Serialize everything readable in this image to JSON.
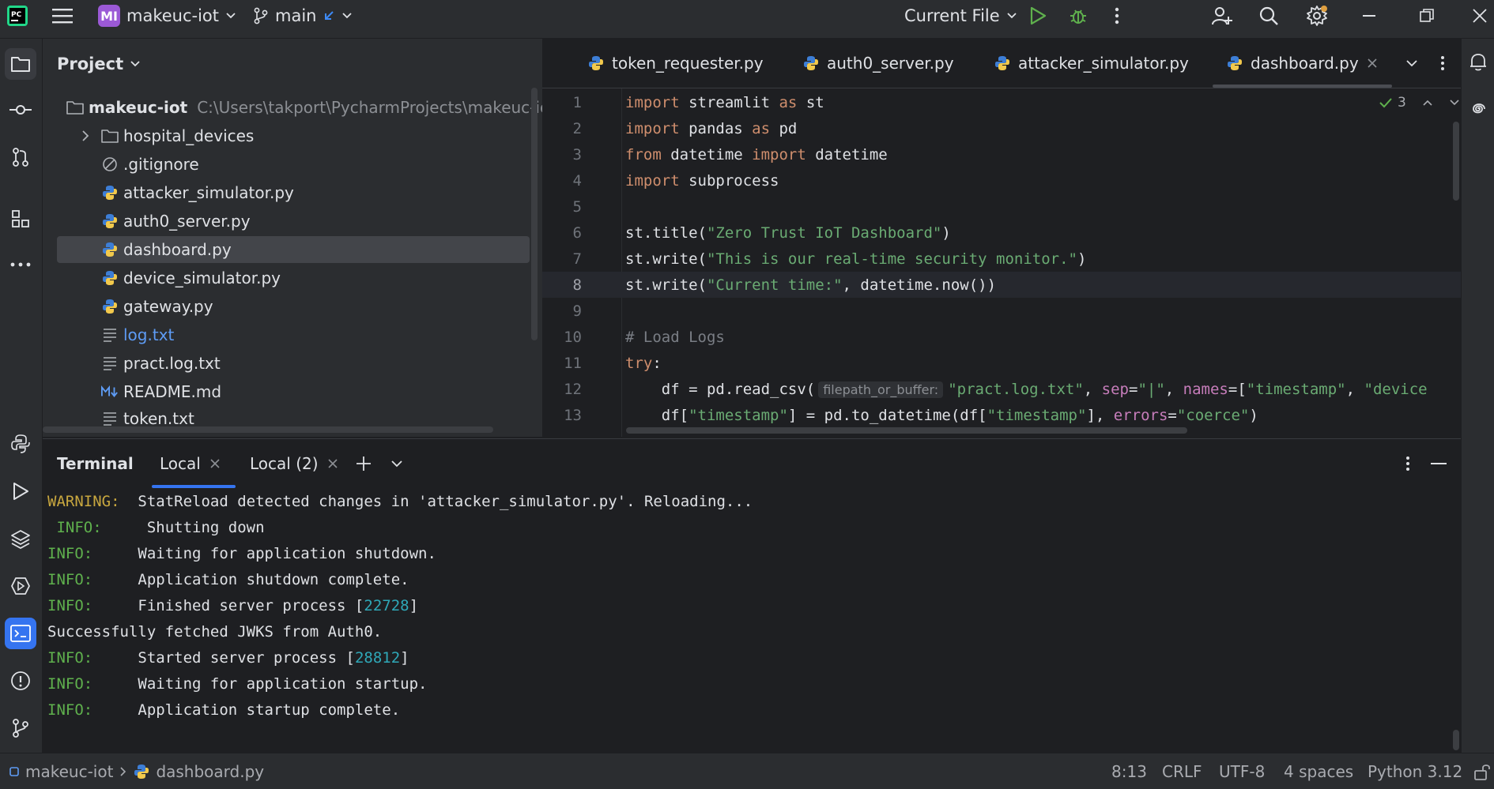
{
  "titlebar": {
    "project_badge": "MI",
    "project_name": "makeuc-iot",
    "branch": "main",
    "run_config": "Current File"
  },
  "project_panel": {
    "title": "Project",
    "root_name": "makeuc-iot",
    "root_path": "C:\\Users\\takport\\PycharmProjects\\makeuc-iot",
    "items": [
      {
        "label": "hospital_devices",
        "icon": "folder-icon"
      },
      {
        "label": ".gitignore",
        "icon": "ignore-file-icon"
      },
      {
        "label": "attacker_simulator.py",
        "icon": "python-file-icon"
      },
      {
        "label": "auth0_server.py",
        "icon": "python-file-icon"
      },
      {
        "label": "dashboard.py",
        "icon": "python-file-icon"
      },
      {
        "label": "device_simulator.py",
        "icon": "python-file-icon"
      },
      {
        "label": "gateway.py",
        "icon": "python-file-icon"
      },
      {
        "label": "log.txt",
        "icon": "text-file-icon"
      },
      {
        "label": "pract.log.txt",
        "icon": "text-file-icon"
      },
      {
        "label": "README.md",
        "icon": "markdown-file-icon"
      },
      {
        "label": "token.txt",
        "icon": "text-file-icon"
      }
    ]
  },
  "editor": {
    "tabs": [
      "token_requester.py",
      "auth0_server.py",
      "attacker_simulator.py",
      "dashboard.py"
    ],
    "active_tab": "dashboard.py",
    "inspection_count": "3",
    "line_numbers": [
      "1",
      "2",
      "3",
      "4",
      "5",
      "6",
      "7",
      "8",
      "9",
      "10",
      "11",
      "12",
      "13"
    ],
    "inlay_hint": "filepath_or_buffer:",
    "code": {
      "l1": {
        "a": "import",
        "b": " streamlit ",
        "c": "as",
        "d": " st"
      },
      "l2": {
        "a": "import",
        "b": " pandas ",
        "c": "as",
        "d": " pd"
      },
      "l3": {
        "a": "from",
        "b": " datetime ",
        "c": "import",
        "d": " datetime"
      },
      "l4": {
        "a": "import",
        "b": " subprocess"
      },
      "l6": {
        "a": "st.title(",
        "b": "\"Zero Trust IoT Dashboard\"",
        "c": ")"
      },
      "l7": {
        "a": "st.write(",
        "b": "\"This is our real-time security monitor.\"",
        "c": ")"
      },
      "l8": {
        "a": "st.write(",
        "b": "\"Current time:\"",
        "c": ", datetime.now())"
      },
      "l10": {
        "a": "# Load Logs"
      },
      "l11": {
        "a": "try",
        "b": ":"
      },
      "l12": {
        "a": "    df = pd.read_csv(",
        "b": "\"pract.log.txt\"",
        "c": ", ",
        "d": "sep",
        "e": "=",
        "f": "\"|\"",
        "g": ", ",
        "h": "names",
        "i": "=[",
        "j": "\"timestamp\"",
        "k": ", ",
        "l": "\"device"
      },
      "l13": {
        "a": "    df[",
        "b": "\"timestamp\"",
        "c": "] = pd.to_datetime(df[",
        "d": "\"timestamp\"",
        "e": "], ",
        "f": "errors",
        "g": "=",
        "h": "\"coerce\"",
        "i": ")"
      }
    }
  },
  "terminal": {
    "title": "Terminal",
    "tabs": [
      "Local",
      "Local (2)"
    ],
    "lines": [
      {
        "level": "WARNING:",
        "text": "  StatReload detected changes in 'attacker_simulator.py'. Reloading..."
      },
      {
        "level": " INFO:",
        "text": "     Shutting down"
      },
      {
        "level": "INFO:",
        "text": "     Waiting for application shutdown."
      },
      {
        "level": "INFO:",
        "text": "     Application shutdown complete."
      },
      {
        "level": "INFO:",
        "text": "     Finished server process [",
        "num": "22728",
        "end": "]"
      },
      {
        "level": "",
        "text": "Successfully fetched JWKS from Auth0."
      },
      {
        "level": "INFO:",
        "text": "     Started server process [",
        "num": "28812",
        "end": "]"
      },
      {
        "level": "INFO:",
        "text": "     Waiting for application startup."
      },
      {
        "level": "INFO:",
        "text": "     Application startup complete."
      }
    ]
  },
  "statusbar": {
    "breadcrumb_project": "makeuc-iot",
    "breadcrumb_file": "dashboard.py",
    "position": "8:13",
    "line_sep": "CRLF",
    "encoding": "UTF-8",
    "indent": "4 spaces",
    "interpreter": "Python 3.12"
  },
  "colors": {
    "accent": "#3574f0",
    "keyword": "#cf8e6d",
    "string": "#6aab73",
    "info": "#5fb04d",
    "warning": "#c8a73f"
  }
}
